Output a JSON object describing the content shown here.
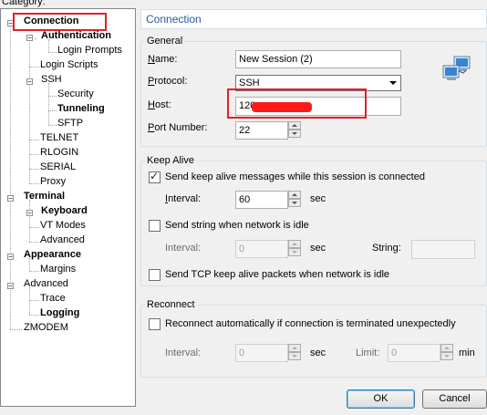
{
  "category_label": "Category:",
  "tree": {
    "items": [
      {
        "label": "Connection",
        "bold": true
      },
      {
        "label": "Authentication",
        "bold": true
      },
      {
        "label": "Login Prompts",
        "bold": false
      },
      {
        "label": "Login Scripts",
        "bold": false
      },
      {
        "label": "SSH",
        "bold": false
      },
      {
        "label": "Security",
        "bold": false
      },
      {
        "label": "Tunneling",
        "bold": true
      },
      {
        "label": "SFTP",
        "bold": false
      },
      {
        "label": "TELNET",
        "bold": false
      },
      {
        "label": "RLOGIN",
        "bold": false
      },
      {
        "label": "SERIAL",
        "bold": false
      },
      {
        "label": "Proxy",
        "bold": false
      },
      {
        "label": "Terminal",
        "bold": true
      },
      {
        "label": "Keyboard",
        "bold": true
      },
      {
        "label": "VT Modes",
        "bold": false
      },
      {
        "label": "Advanced",
        "bold": false
      },
      {
        "label": "Appearance",
        "bold": true
      },
      {
        "label": "Margins",
        "bold": false
      },
      {
        "label": "Advanced",
        "bold": false
      },
      {
        "label": "Trace",
        "bold": false
      },
      {
        "label": "Logging",
        "bold": true
      },
      {
        "label": "ZMODEM",
        "bold": false
      }
    ]
  },
  "header_title": "Connection",
  "general": {
    "title": "General",
    "name_label": "Name:",
    "name_value": "New Session (2)",
    "protocol_label": "Protocol:",
    "protocol_value": "SSH",
    "host_label": "Host:",
    "host_value": "120",
    "port_label": "Port Number:",
    "port_value": "22"
  },
  "keepalive": {
    "title": "Keep Alive",
    "send_keepalive_label": "Send keep alive messages while this session is connected",
    "send_keepalive_checked": true,
    "interval_label": "Interval:",
    "interval_value": "60",
    "sec": "sec",
    "send_string_label": "Send string when network is idle",
    "send_string_checked": false,
    "interval2_label": "Interval:",
    "interval2_value": "0",
    "string_label": "String:",
    "string_value": "",
    "send_tcp_label": "Send TCP keep alive packets when network is idle",
    "send_tcp_checked": false
  },
  "reconnect": {
    "title": "Reconnect",
    "reconnect_label": "Reconnect automatically if connection is terminated unexpectedly",
    "reconnect_checked": false,
    "interval_label": "Interval:",
    "interval_value": "0",
    "sec": "sec",
    "limit_label": "Limit:",
    "limit_value": "0",
    "min": "min"
  },
  "buttons": {
    "ok": "OK",
    "cancel": "Cancel"
  },
  "colors": {
    "header_text": "#2a5aa0",
    "highlight": "#e0202a"
  }
}
